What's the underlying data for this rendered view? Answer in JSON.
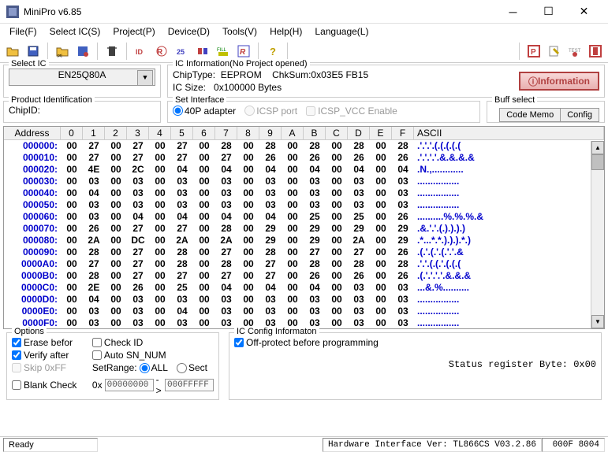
{
  "window": {
    "title": "MiniPro v6.85"
  },
  "menu": {
    "file": "File(F)",
    "selectic": "Select IC(S)",
    "project": "Project(P)",
    "device": "Device(D)",
    "tools": "Tools(V)",
    "help": "Help(H)",
    "language": "Language(L)"
  },
  "selectic": {
    "legend": "Select IC",
    "value": "EN25Q80A"
  },
  "icinfo": {
    "legend": "IC Information(No Project opened)",
    "chiptype_label": "ChipType:",
    "chiptype": "EEPROM",
    "chksum_label": "ChkSum:",
    "chksum": "0x03E5 FB15",
    "icsize_label": "IC Size:",
    "icsize": "0x100000 Bytes",
    "info_btn": "Information"
  },
  "prodid": {
    "legend": "Product Identification",
    "chipid_label": "ChipID:"
  },
  "setif": {
    "legend": "Set Interface",
    "opt_40p": "40P adapter",
    "opt_icsp": "ICSP port",
    "opt_vcc": "ICSP_VCC Enable"
  },
  "buffsel": {
    "legend": "Buff select",
    "tab_code": "Code Memo",
    "tab_config": "Config"
  },
  "hex": {
    "header_addr": "Address",
    "cols": [
      "0",
      "1",
      "2",
      "3",
      "4",
      "5",
      "6",
      "7",
      "8",
      "9",
      "A",
      "B",
      "C",
      "D",
      "E",
      "F"
    ],
    "header_ascii": "ASCII",
    "rows": [
      {
        "addr": "000000:",
        "bytes": [
          "00",
          "27",
          "00",
          "27",
          "00",
          "27",
          "00",
          "28",
          "00",
          "28",
          "00",
          "28",
          "00",
          "28",
          "00",
          "28"
        ],
        "ascii": ".'.'.'.(.(.(.(.("
      },
      {
        "addr": "000010:",
        "bytes": [
          "00",
          "27",
          "00",
          "27",
          "00",
          "27",
          "00",
          "27",
          "00",
          "26",
          "00",
          "26",
          "00",
          "26",
          "00",
          "26"
        ],
        "ascii": ".'.'.'.'.&.&.&.&"
      },
      {
        "addr": "000020:",
        "bytes": [
          "00",
          "4E",
          "00",
          "2C",
          "00",
          "04",
          "00",
          "04",
          "00",
          "04",
          "00",
          "04",
          "00",
          "04",
          "00",
          "04"
        ],
        "ascii": ".N.,............"
      },
      {
        "addr": "000030:",
        "bytes": [
          "00",
          "03",
          "00",
          "03",
          "00",
          "03",
          "00",
          "03",
          "00",
          "03",
          "00",
          "03",
          "00",
          "03",
          "00",
          "03"
        ],
        "ascii": "................"
      },
      {
        "addr": "000040:",
        "bytes": [
          "00",
          "04",
          "00",
          "03",
          "00",
          "03",
          "00",
          "03",
          "00",
          "03",
          "00",
          "03",
          "00",
          "03",
          "00",
          "03"
        ],
        "ascii": "................"
      },
      {
        "addr": "000050:",
        "bytes": [
          "00",
          "03",
          "00",
          "03",
          "00",
          "03",
          "00",
          "03",
          "00",
          "03",
          "00",
          "03",
          "00",
          "03",
          "00",
          "03"
        ],
        "ascii": "................"
      },
      {
        "addr": "000060:",
        "bytes": [
          "00",
          "03",
          "00",
          "04",
          "00",
          "04",
          "00",
          "04",
          "00",
          "04",
          "00",
          "25",
          "00",
          "25",
          "00",
          "26"
        ],
        "ascii": "..........%.%.%.&"
      },
      {
        "addr": "000070:",
        "bytes": [
          "00",
          "26",
          "00",
          "27",
          "00",
          "27",
          "00",
          "28",
          "00",
          "29",
          "00",
          "29",
          "00",
          "29",
          "00",
          "29"
        ],
        "ascii": ".&.'.'.(.).).).)"
      },
      {
        "addr": "000080:",
        "bytes": [
          "00",
          "2A",
          "00",
          "DC",
          "00",
          "2A",
          "00",
          "2A",
          "00",
          "29",
          "00",
          "29",
          "00",
          "2A",
          "00",
          "29"
        ],
        "ascii": ".*...*.*.).).).*.)"
      },
      {
        "addr": "000090:",
        "bytes": [
          "00",
          "28",
          "00",
          "27",
          "00",
          "28",
          "00",
          "27",
          "00",
          "28",
          "00",
          "27",
          "00",
          "27",
          "00",
          "26"
        ],
        "ascii": ".(.'.(.'.(.'.'.&"
      },
      {
        "addr": "0000A0:",
        "bytes": [
          "00",
          "27",
          "00",
          "27",
          "00",
          "28",
          "00",
          "28",
          "00",
          "27",
          "00",
          "28",
          "00",
          "28",
          "00",
          "28"
        ],
        "ascii": ".'.'.(.(.'.(.(.("
      },
      {
        "addr": "0000B0:",
        "bytes": [
          "00",
          "28",
          "00",
          "27",
          "00",
          "27",
          "00",
          "27",
          "00",
          "27",
          "00",
          "26",
          "00",
          "26",
          "00",
          "26"
        ],
        "ascii": ".(.'.'.'.'.&.&.&"
      },
      {
        "addr": "0000C0:",
        "bytes": [
          "00",
          "2E",
          "00",
          "26",
          "00",
          "25",
          "00",
          "04",
          "00",
          "04",
          "00",
          "04",
          "00",
          "03",
          "00",
          "03"
        ],
        "ascii": "...&.%.........."
      },
      {
        "addr": "0000D0:",
        "bytes": [
          "00",
          "04",
          "00",
          "03",
          "00",
          "03",
          "00",
          "03",
          "00",
          "03",
          "00",
          "03",
          "00",
          "03",
          "00",
          "03"
        ],
        "ascii": "................"
      },
      {
        "addr": "0000E0:",
        "bytes": [
          "00",
          "03",
          "00",
          "03",
          "00",
          "04",
          "00",
          "03",
          "00",
          "03",
          "00",
          "03",
          "00",
          "03",
          "00",
          "03"
        ],
        "ascii": "................"
      },
      {
        "addr": "0000F0:",
        "bytes": [
          "00",
          "03",
          "00",
          "03",
          "00",
          "03",
          "00",
          "03",
          "00",
          "03",
          "00",
          "03",
          "00",
          "03",
          "00",
          "03"
        ],
        "ascii": "................"
      }
    ]
  },
  "options": {
    "legend": "Options",
    "erase": "Erase befor",
    "checkid": "Check ID",
    "verify": "Verify after",
    "autosn": "Auto SN_NUM",
    "skipff": "Skip 0xFF",
    "setrange": "SetRange:",
    "all": "ALL",
    "sect": "Sect",
    "blank": "Blank Check",
    "ox": "0x",
    "from": "00000000",
    "to": "000FFFFF",
    "arrow": "->"
  },
  "icconfig": {
    "legend": "IC Config Informaton",
    "offprotect": "Off-protect before programming",
    "status": "Status register Byte: 0x00"
  },
  "status": {
    "ready": "Ready",
    "hwver": "Hardware Interface Ver: TL866CS V03.2.86",
    "addr": "000F 8004"
  }
}
